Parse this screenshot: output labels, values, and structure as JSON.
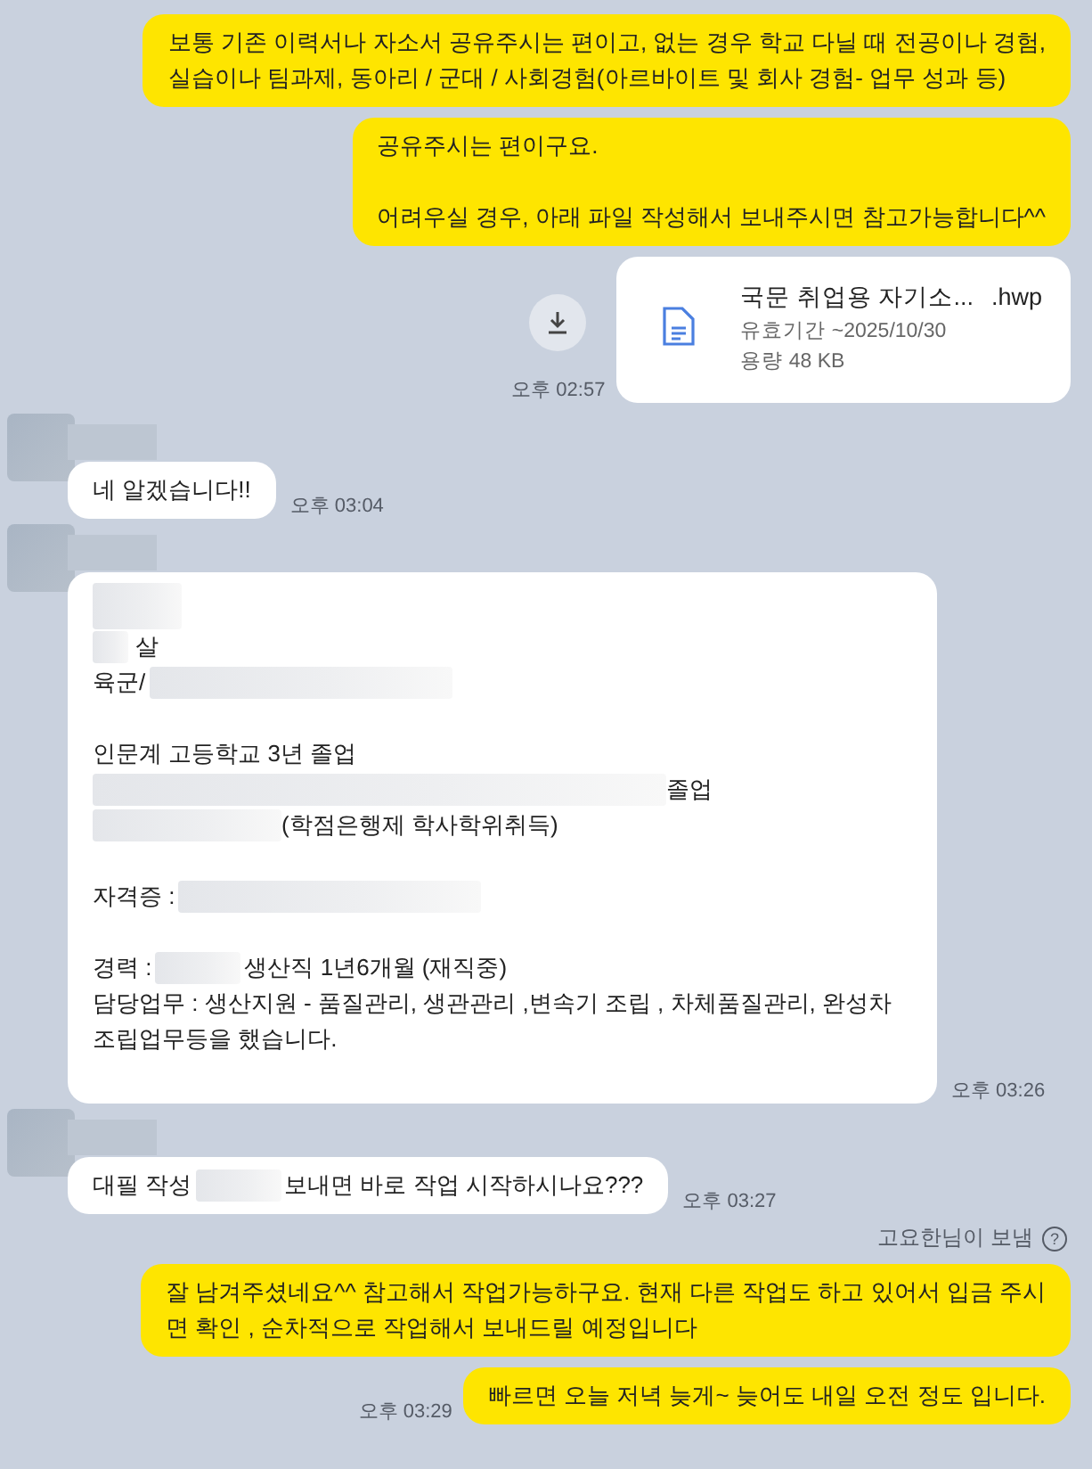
{
  "messages": [
    {
      "kind": "text",
      "mine": true,
      "lines": [
        {
          "kind": "text",
          "segments": [
            {
              "kind": "text",
              "text": "보통 기존 이력서나 자소서 공유주시는 편이고, 없는 경우 학교 다닐 때 전공이나 경험,"
            }
          ]
        },
        {
          "kind": "text",
          "segments": [
            {
              "kind": "text",
              "text": "실습이나 팀과제, 동아리 / 군대 / 사회경험(아르바이트 및 회사 경험- 업무 성과 등)"
            }
          ]
        }
      ]
    },
    {
      "kind": "text",
      "mine": true,
      "lines": [
        {
          "kind": "text",
          "segments": [
            {
              "kind": "text",
              "text": "공유주시는 편이구요."
            }
          ]
        },
        {
          "kind": "blank"
        },
        {
          "kind": "text",
          "segments": [
            {
              "kind": "text",
              "text": "어려우실 경우, 아래 파일 작성해서 보내주시면 참고가능합니다^^"
            }
          ]
        }
      ]
    },
    {
      "kind": "file",
      "mine": true,
      "time": "오후 02:57",
      "file_name": "국문 취업용 자기소...",
      "file_ext": ".hwp",
      "expiry": "유효기간 ~2025/10/30",
      "size": "용량 48 KB"
    },
    {
      "kind": "text",
      "mine": false,
      "time": "오후 03:04",
      "lines": [
        {
          "kind": "text",
          "segments": [
            {
              "kind": "text",
              "text": "네 알겠습니다!!"
            }
          ]
        }
      ]
    },
    {
      "kind": "text",
      "mine": false,
      "time": "오후 03:26",
      "lines": [
        {
          "kind": "text",
          "segments": [
            {
              "kind": "blur-tall"
            }
          ]
        },
        {
          "kind": "text",
          "segments": [
            {
              "kind": "blur-xs"
            },
            {
              "kind": "text",
              "text": "살"
            }
          ]
        },
        {
          "kind": "text",
          "segments": [
            {
              "kind": "text",
              "text": "육군/"
            },
            {
              "kind": "blur-l"
            }
          ]
        },
        {
          "kind": "blank"
        },
        {
          "kind": "text",
          "segments": [
            {
              "kind": "text",
              "text": "인문계 고등학교 3년 졸업"
            }
          ]
        },
        {
          "kind": "text",
          "segments": [
            {
              "kind": "blur-xl"
            },
            {
              "kind": "text",
              "text": "졸업"
            }
          ]
        },
        {
          "kind": "text",
          "segments": [
            {
              "kind": "blur-m"
            },
            {
              "kind": "text",
              "text": "(학점은행제 학사학위취득)"
            }
          ]
        },
        {
          "kind": "blank"
        },
        {
          "kind": "text",
          "segments": [
            {
              "kind": "text",
              "text": "자격증 :"
            },
            {
              "kind": "blur-l"
            }
          ]
        },
        {
          "kind": "blank"
        },
        {
          "kind": "text",
          "segments": [
            {
              "kind": "text",
              "text": "경력 :"
            },
            {
              "kind": "blur-s"
            },
            {
              "kind": "text",
              "text": "생산직 1년6개월 (재직중)"
            }
          ]
        },
        {
          "kind": "text",
          "segments": [
            {
              "kind": "text",
              "text": "담당업무 : 생산지원 - 품질관리, 생관관리 ,변속기 조립 , 차체품질관리, 완성차 조립업무등을 했습니다."
            }
          ]
        },
        {
          "kind": "blank"
        }
      ]
    },
    {
      "kind": "text",
      "mine": false,
      "time": "오후 03:27",
      "lines": [
        {
          "kind": "text",
          "segments": [
            {
              "kind": "text",
              "text": "대필 작성"
            },
            {
              "kind": "blur-s"
            },
            {
              "kind": "text",
              "text": "보내면 바로 작업 시작하시나요???"
            }
          ]
        }
      ]
    },
    {
      "kind": "note",
      "text": "고요한님이 보냄",
      "icon": "?"
    },
    {
      "kind": "text",
      "mine": true,
      "lines": [
        {
          "kind": "text",
          "segments": [
            {
              "kind": "text",
              "text": "잘 남겨주셨네요^^ 참고해서 작업가능하구요. 현재 다른 작업도 하고 있어서 입금 주시"
            }
          ]
        },
        {
          "kind": "text",
          "segments": [
            {
              "kind": "text",
              "text": "면 확인 , 순차적으로 작업해서 보내드릴 예정입니다"
            }
          ]
        }
      ]
    },
    {
      "kind": "text",
      "mine": true,
      "time": "오후 03:29",
      "lines": [
        {
          "kind": "text",
          "segments": [
            {
              "kind": "text",
              "text": "빠르면 오늘 저녁 늦게~ 늦어도 내일 오전 정도 입니다."
            }
          ]
        }
      ]
    }
  ]
}
